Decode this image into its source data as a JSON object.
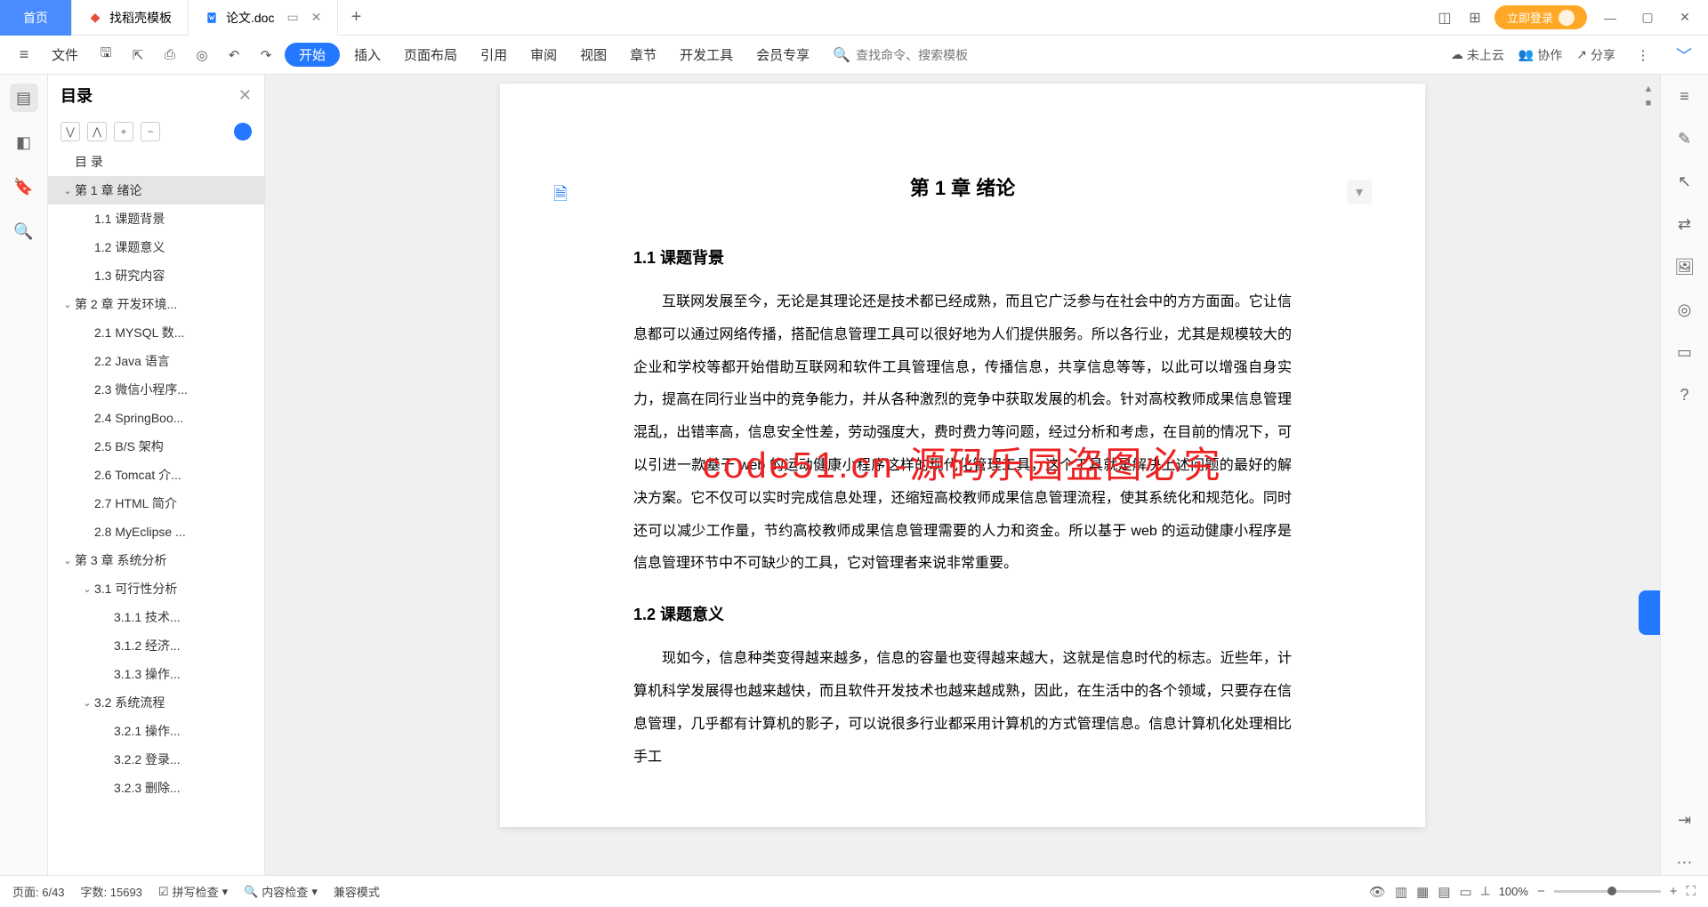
{
  "titlebar": {
    "home": "首页",
    "tabs": [
      {
        "icon": "red",
        "label": "找稻壳模板"
      },
      {
        "icon": "blue",
        "label": "论文.doc",
        "active": true
      }
    ],
    "login": "立即登录"
  },
  "toolbar": {
    "file": "文件",
    "menus": [
      "插入",
      "页面布局",
      "引用",
      "审阅",
      "视图",
      "章节",
      "开发工具",
      "会员专享"
    ],
    "start": "开始",
    "search_placeholder": "查找命令、搜索模板",
    "cloud": "未上云",
    "collab": "协作",
    "share": "分享"
  },
  "outline": {
    "title": "目录",
    "items": [
      {
        "level": 0,
        "chev": "",
        "text": "目 录"
      },
      {
        "level": 0,
        "chev": "v",
        "text": "第 1 章 绪论",
        "selected": true
      },
      {
        "level": 1,
        "chev": "",
        "text": "1.1 课题背景"
      },
      {
        "level": 1,
        "chev": "",
        "text": "1.2 课题意义"
      },
      {
        "level": 1,
        "chev": "",
        "text": "1.3 研究内容"
      },
      {
        "level": 0,
        "chev": "v",
        "text": "第 2 章 开发环境..."
      },
      {
        "level": 1,
        "chev": "",
        "text": "2.1 MYSQL 数..."
      },
      {
        "level": 1,
        "chev": "",
        "text": "2.2 Java 语言"
      },
      {
        "level": 1,
        "chev": "",
        "text": "2.3 微信小程序..."
      },
      {
        "level": 1,
        "chev": "",
        "text": "2.4 SpringBoo..."
      },
      {
        "level": 1,
        "chev": "",
        "text": "2.5 B/S 架构"
      },
      {
        "level": 1,
        "chev": "",
        "text": "2.6 Tomcat 介..."
      },
      {
        "level": 1,
        "chev": "",
        "text": "2.7 HTML 简介"
      },
      {
        "level": 1,
        "chev": "",
        "text": "2.8 MyEclipse ..."
      },
      {
        "level": 0,
        "chev": "v",
        "text": "第 3 章 系统分析"
      },
      {
        "level": 1,
        "chev": "v",
        "text": "3.1 可行性分析"
      },
      {
        "level": 2,
        "chev": "",
        "text": "3.1.1 技术..."
      },
      {
        "level": 2,
        "chev": "",
        "text": "3.1.2 经济..."
      },
      {
        "level": 2,
        "chev": "",
        "text": "3.1.3 操作..."
      },
      {
        "level": 1,
        "chev": "v",
        "text": "3.2 系统流程"
      },
      {
        "level": 2,
        "chev": "",
        "text": "3.2.1 操作..."
      },
      {
        "level": 2,
        "chev": "",
        "text": "3.2.2 登录..."
      },
      {
        "level": 2,
        "chev": "",
        "text": "3.2.3 删除..."
      }
    ]
  },
  "doc": {
    "chapter": "第 1 章 绪论",
    "s1": "1.1 课题背景",
    "p1": "互联网发展至今，无论是其理论还是技术都已经成熟，而且它广泛参与在社会中的方方面面。它让信息都可以通过网络传播，搭配信息管理工具可以很好地为人们提供服务。所以各行业，尤其是规模较大的企业和学校等都开始借助互联网和软件工具管理信息，传播信息，共享信息等等，以此可以增强自身实力，提高在同行业当中的竞争能力，并从各种激烈的竞争中获取发展的机会。针对高校教师成果信息管理混乱，出错率高，信息安全性差，劳动强度大，费时费力等问题，经过分析和考虑，在目前的情况下，可以引进一款基于 web 的运动健康小程序这样的现代化管理工具，这个工具就是解决上述问题的最好的解决方案。它不仅可以实时完成信息处理，还缩短高校教师成果信息管理流程，使其系统化和规范化。同时还可以减少工作量，节约高校教师成果信息管理需要的人力和资金。所以基于 web 的运动健康小程序是信息管理环节中不可缺少的工具，它对管理者来说非常重要。",
    "s2": "1.2 课题意义",
    "p2": "现如今，信息种类变得越来越多，信息的容量也变得越来越大，这就是信息时代的标志。近些年，计算机科学发展得也越来越快，而且软件开发技术也越来越成熟，因此，在生活中的各个领域，只要存在信息管理，几乎都有计算机的影子，可以说很多行业都采用计算机的方式管理信息。信息计算机化处理相比手工",
    "watermark": "code51.cn-源码乐园盗图必究"
  },
  "status": {
    "page": "页面: 6/43",
    "words": "字数: 15693",
    "spell": "拼写检查",
    "content": "内容检查",
    "compat": "兼容模式",
    "zoom": "100%"
  }
}
